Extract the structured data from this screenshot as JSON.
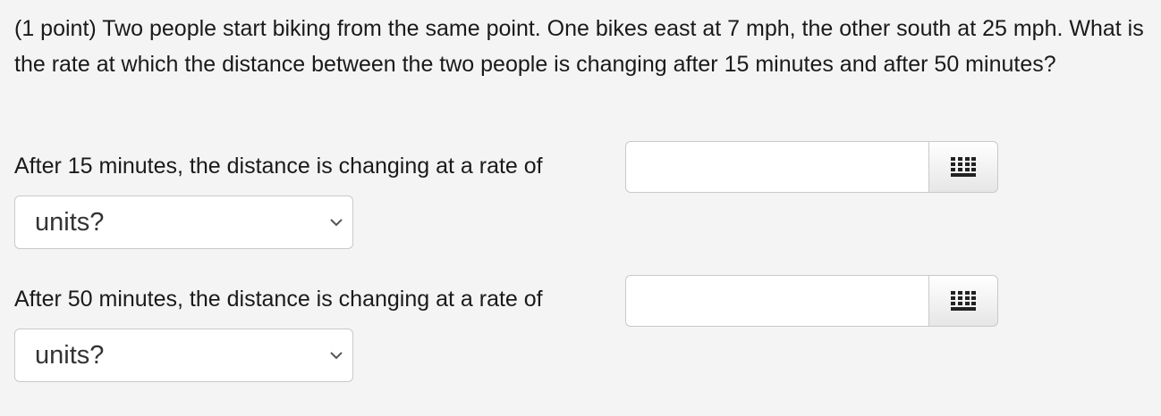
{
  "problem": {
    "text": "(1 point) Two people start biking from the same point. One bikes east at 7 mph, the other south at 25 mph. What is the rate at which the distance between the two people is changing after 15 minutes and after 50 minutes?"
  },
  "questions": [
    {
      "label": "After 15 minutes, the distance is changing at a rate of",
      "answer_value": "",
      "units_selected": "units?"
    },
    {
      "label": "After 50 minutes, the distance is changing at a rate of",
      "answer_value": "",
      "units_selected": "units?"
    }
  ],
  "icons": {
    "palette": "grid-icon",
    "dropdown": "chevron-down-icon"
  }
}
